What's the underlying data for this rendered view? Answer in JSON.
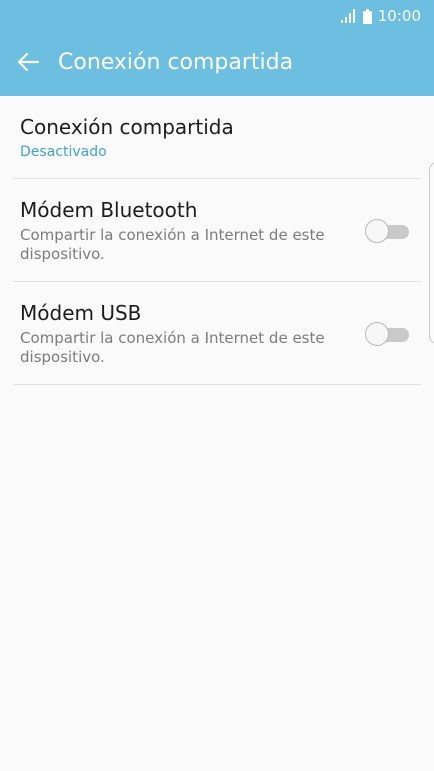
{
  "status_bar": {
    "time": "10:00",
    "signal_icon": "signal-icon",
    "battery_icon": "battery-icon"
  },
  "app_bar": {
    "title": "Conexión compartida",
    "back_icon": "arrow-left-icon",
    "color": "#6cbfe0"
  },
  "settings": {
    "tethering": {
      "title": "Conexión compartida",
      "status": "Desactivado",
      "status_color": "#3fa5cc"
    },
    "bluetooth_modem": {
      "title": "Módem Bluetooth",
      "description": "Compartir la conexión a Internet de este dispositivo.",
      "enabled": false
    },
    "usb_modem": {
      "title": "Módem USB",
      "description": "Compartir la conexión a Internet de este dispositivo.",
      "enabled": false
    }
  }
}
